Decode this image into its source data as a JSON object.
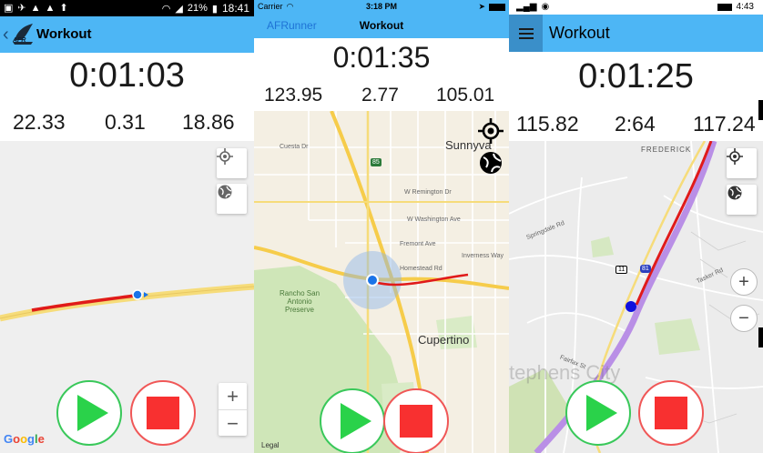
{
  "panels": [
    {
      "status_bar": {
        "battery": "21%",
        "time": "18:41"
      },
      "header": {
        "title": "Workout",
        "logo_text": "AFR"
      },
      "timer": "0:01:03",
      "stats": [
        "22.33",
        "0.31",
        "18.86"
      ],
      "map": {
        "attribution": "Google",
        "zoom_in": "+",
        "zoom_out": "−"
      },
      "buttons": {
        "play": "play",
        "stop": "stop"
      }
    },
    {
      "status_bar": {
        "carrier": "Carrier",
        "time": "3:18 PM"
      },
      "header": {
        "back_label": "AFRunner",
        "title": "Workout"
      },
      "timer": "0:01:35",
      "stats": [
        "123.95",
        "2.77",
        "105.01"
      ],
      "map": {
        "attribution": "Legal",
        "labels": {
          "city_top": "Sunnyva",
          "city_bottom": "Cupertino",
          "park": "Rancho San Antonio Preserve",
          "homestead": "Homestead Rd",
          "fremont": "Fremont Ave",
          "inverness": "Inverness Way",
          "cuesta": "Cuesta Dr",
          "remington": "W Remington Dr",
          "mathilda": "W Washington Ave",
          "hwy": "85"
        }
      },
      "buttons": {
        "play": "play",
        "stop": "stop"
      }
    },
    {
      "status_bar": {
        "time": "4:43"
      },
      "header": {
        "title": "Workout"
      },
      "timer": "0:01:25",
      "stats": [
        "115.82",
        "2:64",
        "117.24"
      ],
      "map": {
        "labels": {
          "frederick": "FREDERICK",
          "springdale": "Springdale Rd",
          "tasker": "Tasker Rd",
          "fairfax": "Fairfax St",
          "route11": "11",
          "route81": "81",
          "watermark": "tephens City"
        },
        "zoom_in": "+",
        "zoom_out": "−"
      },
      "buttons": {
        "play": "play",
        "stop": "stop"
      }
    }
  ],
  "colors": {
    "header": "#4db6f5",
    "route": "#e01a1a",
    "play": "#2ad24a",
    "stop": "#f83030",
    "location_dot": "#1a73e8"
  }
}
